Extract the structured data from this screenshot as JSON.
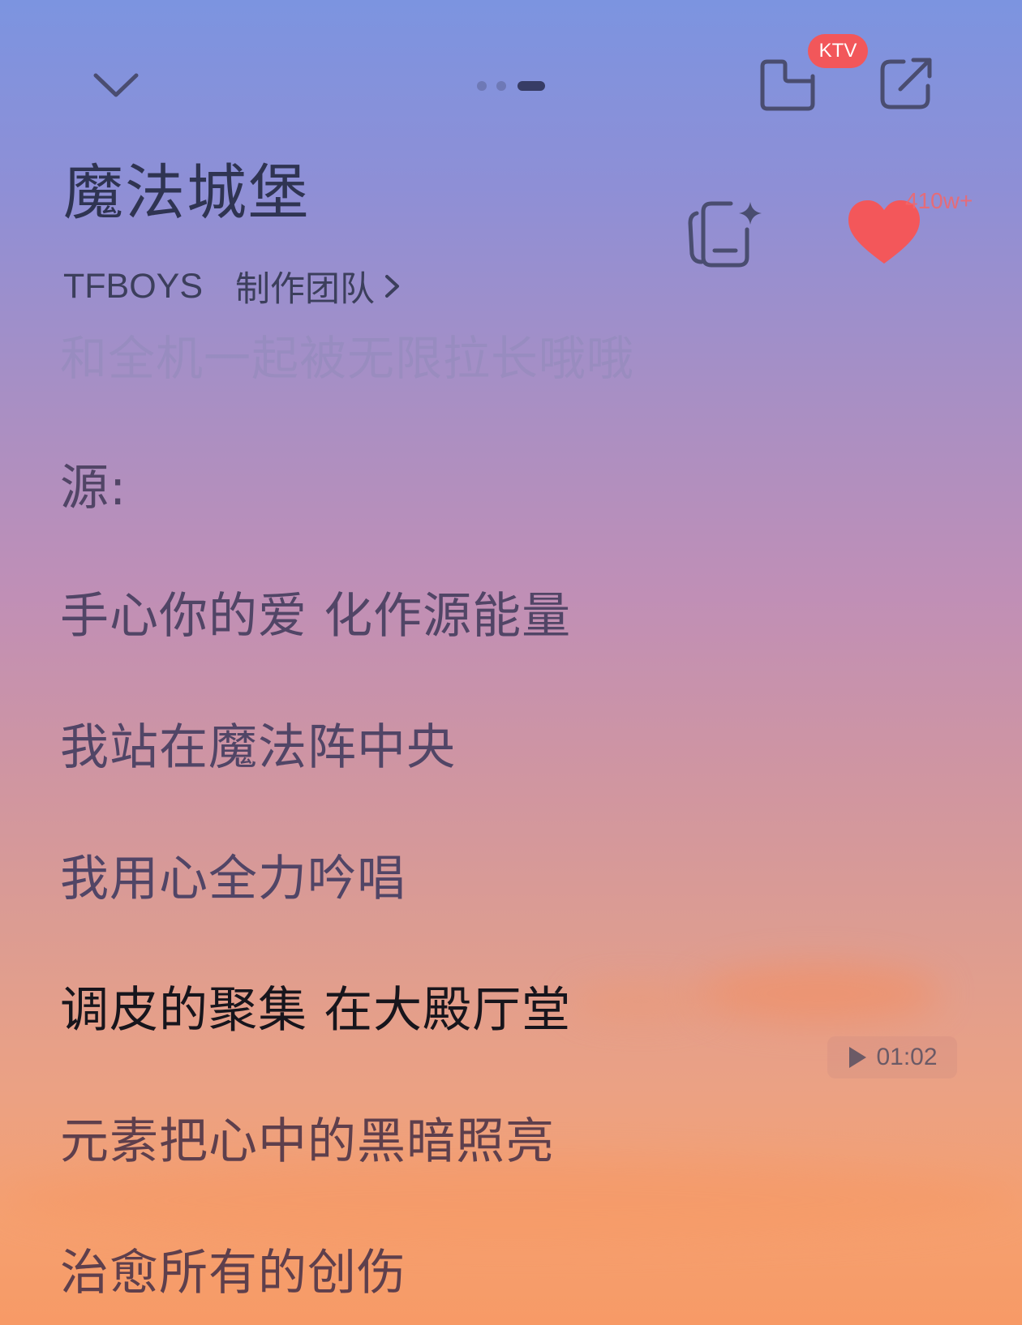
{
  "header": {
    "page_indicator": {
      "count": 3,
      "active_index": 2
    },
    "ktv_badge": "KTV"
  },
  "song": {
    "title": "魔法城堡",
    "artist": "TFBOYS",
    "credits_link": "制作团队",
    "like_count": "410w+"
  },
  "lyrics": {
    "lines": [
      "和全机一起被无限拉长哦哦",
      "源:",
      "手心你的爱 化作源能量",
      "我站在魔法阵中央",
      "我用心全力吟唱",
      "调皮的聚集 在大殿厅堂",
      "元素把心中的黑暗照亮",
      "治愈所有的创伤"
    ],
    "current_index": 5
  },
  "playback": {
    "seek_time": "01:02"
  },
  "icons": {
    "collapse": "chevron-down-icon",
    "ktv": "ktv-icon",
    "share": "share-icon",
    "ai_lyrics": "ai-card-icon",
    "like": "heart-icon",
    "play": "play-icon"
  },
  "colors": {
    "like": "#f3575a",
    "ktv_badge": "#f2575a",
    "icon": "#4a4d70"
  }
}
